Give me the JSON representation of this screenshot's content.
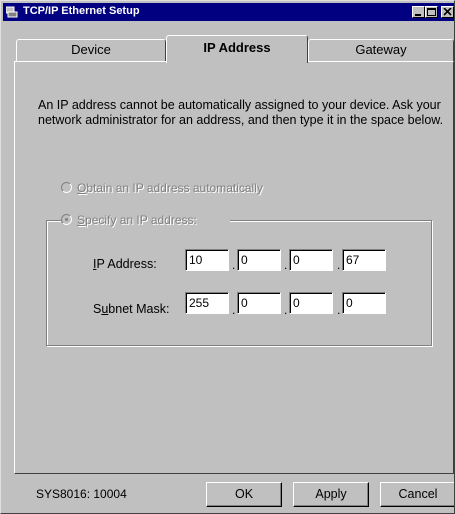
{
  "window": {
    "title": "TCP/IP Ethernet Setup"
  },
  "tabs": [
    {
      "label": "Device",
      "active": false
    },
    {
      "label": "IP Address",
      "active": true
    },
    {
      "label": "Gateway",
      "active": false
    }
  ],
  "info_text": "An IP address cannot be automatically assigned to your device. Ask your network administrator for an address, and then type it in the space below.",
  "options": {
    "auto": {
      "label_prefix": "",
      "accel": "O",
      "label_rest": "btain an IP address automatically",
      "checked": false,
      "enabled": false
    },
    "specify": {
      "label_prefix": "",
      "accel": "S",
      "label_rest": "pecify an IP address:",
      "checked": true,
      "enabled": false
    }
  },
  "ip_address": {
    "label_accel": "I",
    "label_rest": "P Address:",
    "octets": [
      "10",
      "0",
      "0",
      "67"
    ]
  },
  "subnet_mask": {
    "label_prefix": "S",
    "label_accel": "u",
    "label_rest": "bnet Mask:",
    "octets": [
      "255",
      "0",
      "0",
      "0"
    ]
  },
  "status_text": "SYS8016: 10004",
  "buttons": {
    "ok": "OK",
    "apply": "Apply",
    "cancel": "Cancel"
  },
  "colors": {
    "titlebar": "#000080",
    "face": "#c0c0c0",
    "disabled_text": "#808080"
  }
}
